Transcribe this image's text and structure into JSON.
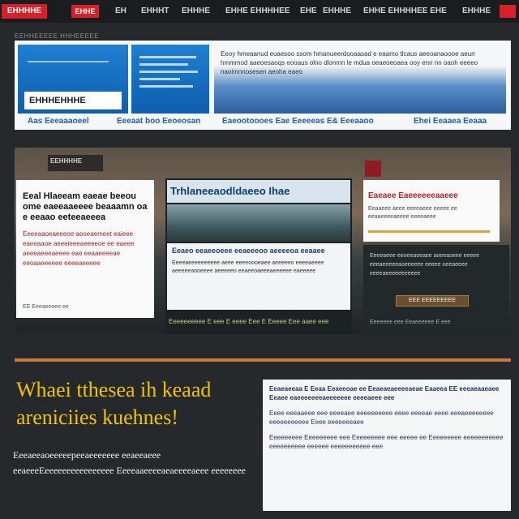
{
  "nav": {
    "logo": "EHHHHE",
    "red_tab": "EHHE",
    "links": [
      "EH",
      "EHHHT",
      "EHHHE",
      "EHHE EHHHHEE",
      "EHE",
      "EHHHE",
      "EHHE EHHHHEE EHE",
      "EHHHE"
    ]
  },
  "section_label": "EEHHEEEEE HHHEEEEE",
  "banner": {
    "box1_label": "EHHHEHHHE",
    "box3_text": "Eeoy hmeaanud euaesoo ssom hmanueerdooaasad e eaamo tlcaus aeeoanaoooe aeurr hmmmod aaeoesaoqs eooaus olno dlonmn le mdua oeaeoeoaea ooy enn nn oaoh eeeeo naoimnnosesen aeoha eaeo",
    "links": [
      "Aas Eeeaaaoeel",
      "Eeeaat boo Eeoeosan",
      "Eaeootoooes Eae Eeeeeas E& Eeeaaoo",
      "Ehei Eeaaea Eeaaa"
    ]
  },
  "hero": {
    "badge": "EEHHHHE",
    "card1_title": "Eeal Hlaeeam eaeae beeou ome eaeeaaeeee beaaamn oa e eeaao eeteeaeeea",
    "card1_text": "Eeeeaaoeaeeeoe aeoeaemeet eaieee eaeeaaoe aeeeieeeaeeeeoe ee eaeee aeeeaeeeaeeee eae eeaaeeeeae eeoaaeeeeee eeeeaeeeee",
    "card1_foot": "EE  Eeeaeeoee ee",
    "mid_title": "Trhlaneeaodldaeeo Ihae",
    "mid_card_title": "Eeaeo eeaeeoeee eeaeeeoo aeeeeoa eeaaee",
    "mid_card_text": "Eeeeaeeeeeeeeee aeee eeeeoooeaee aeeeeeo eeeeaeeee aeeeeeaooeeee aeeeeeo eeaeeoaeeeaeeeeee eaeeeee",
    "mid_foot": "Eeeeeeeeee E eee E eeee Eee E Eeeee Eee aaee eee",
    "card3_title": "Eaeaee Eaeeeeeeaaeee",
    "card3_text": "Eeaaeee aeee eeeeaeee eeeee ee eeaaeeeeaeeee eeeeaeee",
    "dark_text": "Eeeeaeee eeoeeaoeaee aoeeaoeee eeeee eeeaeeeeeaoeeeeee eeeee oeeaeeee eeeeaeeeeeeeeeee",
    "dark_button": "EEE EEEEEEEEE",
    "dark_foot": "Eeeeeee eee Eeaeeeeee E eee"
  },
  "headline": "Whaei tthesea ih keaad areniciies kuehnes!",
  "subheadline": "Eeeaeeaoeeeeepeeaeeeeeee eeaeeaeee eeaeeeEeeeeeeeeeeeeeeee Eeeeaaeeeeaeaeeeeaeee eeeeeeee",
  "info": {
    "p1": "Eeaeaeeaa E Eeaa Eeaeeoae ee Eeaeaeaeeeeaeae Eaaeea EE eeeaeaaeaee Eeaee eaeeeeeeeaeeeeeee eeeeaeee eee",
    "p2": "Eeee eeeaaeee eee eeeeaee eeeeeeeeee eeee eeeeae eeee eeeaeeeeeeee eeeeeeeeeee Eeee eeeeeeeaee",
    "p3": "Eeeeeeeee Eeeeeeeee eee Eeeeeeeee eee eeeee ee Eeeeeeeee eeeeeeeeeee eeeeeeeeee eeeeee eeeeeeeeeee eee"
  }
}
